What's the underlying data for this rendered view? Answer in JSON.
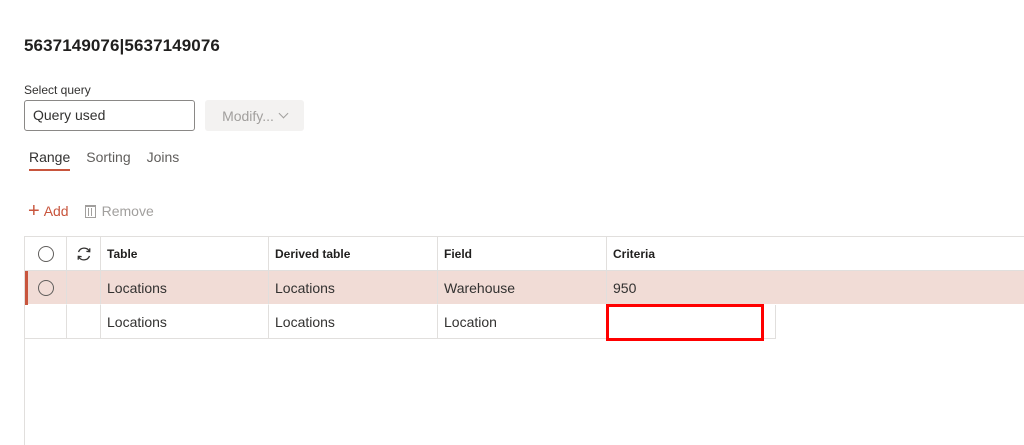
{
  "page": {
    "title": "5637149076|5637149076"
  },
  "query": {
    "label": "Select query",
    "value": "Query used",
    "modify_label": "Modify..."
  },
  "tabs": [
    {
      "label": "Range",
      "active": true
    },
    {
      "label": "Sorting",
      "active": false
    },
    {
      "label": "Joins",
      "active": false
    }
  ],
  "toolbar": {
    "add_label": "Add",
    "remove_label": "Remove"
  },
  "grid": {
    "columns": [
      "Table",
      "Derived table",
      "Field",
      "Criteria"
    ],
    "rows": [
      {
        "table": "Locations",
        "derived_table": "Locations",
        "field": "Warehouse",
        "criteria": "950",
        "selected": true
      },
      {
        "table": "Locations",
        "derived_table": "Locations",
        "field": "Location",
        "criteria": "",
        "selected": false
      }
    ]
  },
  "colors": {
    "accent": "#c8553d",
    "selected_row": "#f1dcd6",
    "highlight": "#ff0000"
  }
}
